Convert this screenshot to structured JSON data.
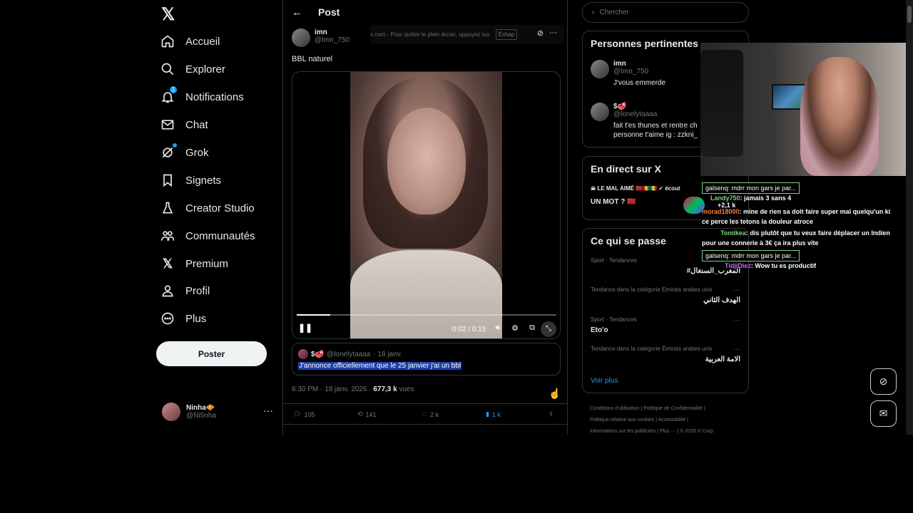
{
  "nav": {
    "items": [
      {
        "label": "Accueil"
      },
      {
        "label": "Explorer"
      },
      {
        "label": "Notifications",
        "badge": "1"
      },
      {
        "label": "Chat"
      },
      {
        "label": "Grok"
      },
      {
        "label": "Signets"
      },
      {
        "label": "Creator Studio"
      },
      {
        "label": "Communautés"
      },
      {
        "label": "Premium"
      },
      {
        "label": "Profil"
      },
      {
        "label": "Plus"
      }
    ],
    "post_button": "Poster",
    "account": {
      "name": "Ninha🧇",
      "handle": "@Ni5nha"
    }
  },
  "post": {
    "header_title": "Post",
    "fullscreen_hint": "x.com - Pour quitter le plein écran, appuyez sur",
    "fullscreen_key": "Échap",
    "author_name": "imn",
    "author_handle": "@Imn_750",
    "text": "BBL naturel",
    "video": {
      "time": "0:02 / 0:15",
      "progress": 0.13
    },
    "quote": {
      "author_name": "$🥩",
      "author_handle": "@lonelytaaaa",
      "date": "· 18 janv.",
      "text": "J'annonce officiellement que le 25 janvier j'ai un bbl"
    },
    "meta": {
      "datetime": "6:30 PM · 18 janv. 2026 ·",
      "views_count": "677,3 k",
      "views_label": "vues"
    },
    "actions": {
      "replies": "105",
      "reposts": "141",
      "likes": "2 k",
      "bookmarks": "1 k"
    }
  },
  "right": {
    "search_placeholder": "Chercher",
    "relevant": {
      "title": "Personnes pertinentes",
      "people": [
        {
          "name": "imn",
          "handle": "@Imn_750",
          "bio": "J'vous emmerde"
        },
        {
          "name": "$🥩",
          "handle": "@lonelytaaaa",
          "bio": "fait t'es thunes et rentre ch personne t'aime ig : zzkni_"
        }
      ]
    },
    "live": {
      "title": "En direct sur X",
      "host": "☠ LE MAL AIMÉ 🇲🇦🇬🇳🇸🇳 ✓ écout",
      "stream_title": "UN MOT ? 🇲🇦"
    },
    "happening": {
      "title": "Ce qui se passe",
      "trends": [
        {
          "category": "Sport · Tendances",
          "name": "#المغرب_السنغال"
        },
        {
          "category": "Tendance dans la catégorie Émirats arabes unis",
          "name": "الهدف الثاني"
        },
        {
          "category": "Sport · Tendances",
          "name": "Eto'o"
        },
        {
          "category": "Tendance dans la catégorie Émirats arabes unis",
          "name": "الامة العربية"
        }
      ],
      "see_more": "Voir plus"
    },
    "footer": [
      "Conditions d'utilisation",
      "Politique de Confidentialité",
      "Politique relative aux cookies",
      "Accessibilité",
      "Informations sur les publicités",
      "Plus ···",
      "© 2026 X Corp."
    ]
  },
  "chat": {
    "lines": [
      {
        "kind": "reply",
        "text": "galsenq: mdrr mon gars je par..."
      },
      {
        "kind": "msg",
        "user": "Landy750",
        "text": ": jamais 3 sans 4"
      },
      {
        "kind": "count",
        "text": "+2,1 k"
      },
      {
        "kind": "msg",
        "user": "morad18000",
        "text": ": mine de rien sa doit faire super mal quelqu'un ki"
      },
      {
        "kind": "cont",
        "text": "ce perce les tetons la douleur atroce"
      },
      {
        "kind": "msg",
        "user": "Toniikea",
        "text": ": dis plutôt que tu veux faire déplacer un Indien"
      },
      {
        "kind": "cont",
        "text": "pour une connerie à 3€ ça ira plus vite"
      },
      {
        "kind": "reply",
        "text": "galsenq: mdrr mon gars je par..."
      },
      {
        "kind": "msg",
        "user": "TidjiDiez",
        "text": ": Wow tu es productif"
      }
    ]
  }
}
